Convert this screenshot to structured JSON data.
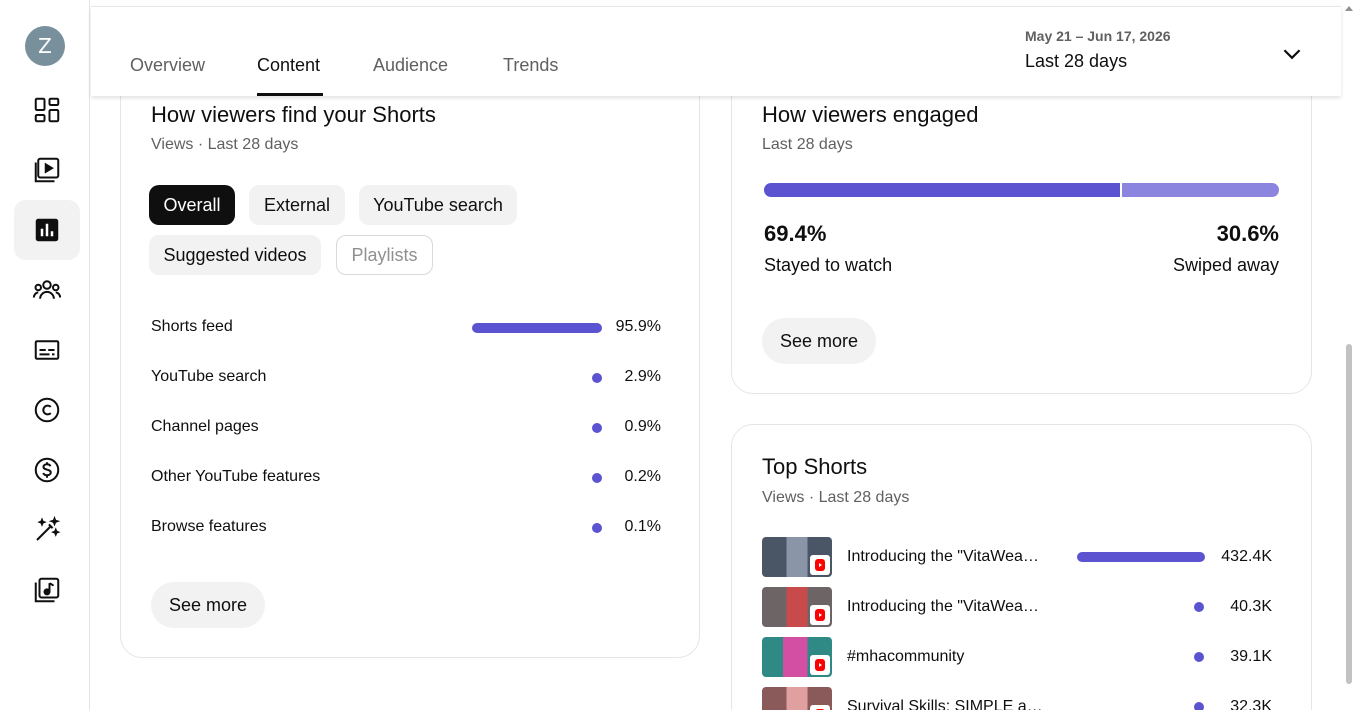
{
  "user": {
    "avatar_letter": "Z"
  },
  "rail": {
    "items": [
      "dashboard-icon",
      "content-icon",
      "analytics-icon",
      "community-icon",
      "subtitles-icon",
      "copyright-icon",
      "earn-icon",
      "customization-icon",
      "audio-library-icon"
    ],
    "active": "analytics-icon"
  },
  "tabs": [
    "Overview",
    "Content",
    "Audience",
    "Trends"
  ],
  "active_tab": "Content",
  "date_filter": {
    "range": "May 21 – Jun 17, 2026",
    "label": "Last 28 days"
  },
  "traffic_card": {
    "title": "How viewers find your Shorts",
    "subtitle": "Views · Last 28 days",
    "chips": [
      {
        "label": "Overall",
        "state": "selected"
      },
      {
        "label": "External",
        "state": "normal"
      },
      {
        "label": "YouTube search",
        "state": "normal"
      },
      {
        "label": "Suggested videos",
        "state": "normal"
      },
      {
        "label": "Playlists",
        "state": "disabled"
      }
    ],
    "sources": [
      {
        "label": "Shorts feed",
        "value": "95.9%",
        "share": 0.959
      },
      {
        "label": "YouTube search",
        "value": "2.9%",
        "share": 0.029
      },
      {
        "label": "Channel pages",
        "value": "0.9%",
        "share": 0.009
      },
      {
        "label": "Other YouTube features",
        "value": "0.2%",
        "share": 0.002
      },
      {
        "label": "Browse features",
        "value": "0.1%",
        "share": 0.001
      }
    ],
    "see_more": "See more"
  },
  "engaged_card": {
    "title": "How viewers engaged",
    "subtitle": "Last 28 days",
    "stayed": {
      "pct": "69.4%",
      "label": "Stayed to watch",
      "share": 0.694
    },
    "swiped": {
      "pct": "30.6%",
      "label": "Swiped away",
      "share": 0.306
    },
    "see_more": "See more"
  },
  "top_shorts_card": {
    "title": "Top Shorts",
    "subtitle": "Views · Last 28 days",
    "items": [
      {
        "title": "Introducing the \"VitaWea…",
        "views": "432.4K",
        "thumb_colors": [
          "#4a5566",
          "#8a96a8"
        ]
      },
      {
        "title": "Introducing the \"VitaWea…",
        "views": "40.3K",
        "thumb_colors": [
          "#6d6565",
          "#c94a4a"
        ]
      },
      {
        "title": "#mhacommunity",
        "views": "39.1K",
        "thumb_colors": [
          "#2f8a86",
          "#d24fa3"
        ]
      },
      {
        "title": "Survival Skills: SIMPLE a…",
        "views": "32.3K",
        "thumb_colors": [
          "#8a5a5a",
          "#e0a0a0"
        ]
      }
    ]
  },
  "colors": {
    "accent": "#5b53cf",
    "accent_light": "#8b85e0"
  }
}
